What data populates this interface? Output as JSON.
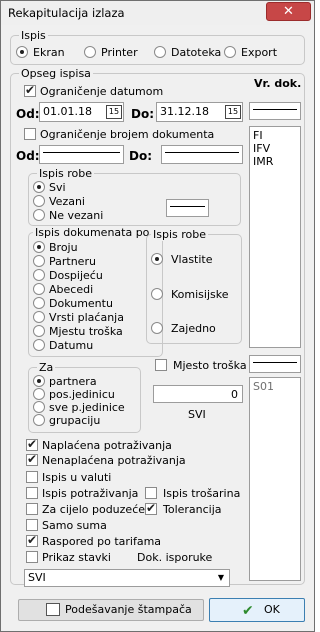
{
  "window": {
    "title": "Rekapitulacija izlaza",
    "close_glyph": "✕"
  },
  "ispis": {
    "title": "Ispis",
    "options": [
      "Ekran",
      "Printer",
      "Datoteka",
      "Export"
    ]
  },
  "opseg": {
    "title": "Opseg ispisa",
    "vr_dok_label": "Vr. dok.",
    "ogranicenje_datumom": "Ograničenje datumom",
    "od_label": "Od:",
    "od_value": "01.01.18",
    "do_label": "Do:",
    "do_value": "31.12.18",
    "cal_glyph": "15",
    "ogranicenje_brojem": "Ograničenje brojem dokumenta",
    "od2_label": "Od:",
    "do2_label": "Do:",
    "doc_types": [
      "FI",
      "IFV",
      "IMR"
    ]
  },
  "ispis_robe1": {
    "title": "Ispis robe",
    "options": [
      "Svi",
      "Vezani",
      "Ne vezani"
    ]
  },
  "ispis_dok": {
    "title": "Ispis dokumenata po",
    "options": [
      "Broju",
      "Partneru",
      "Dospijeću",
      "Abecedi",
      "Dokumentu",
      "Vrsti plaćanja",
      "Mjestu troška",
      "Datumu"
    ]
  },
  "ispis_robe2": {
    "title": "Ispis robe",
    "options": [
      "Vlastite",
      "Komisijske",
      "Zajedno"
    ]
  },
  "mjesto_troska": "Mjesto troška",
  "za": {
    "title": "Za",
    "options": [
      "partnera",
      "pos.jedinicu",
      "sve p.jedinice",
      "grupaciju"
    ]
  },
  "counter": {
    "value": "0",
    "label": "SVI"
  },
  "s_list": [
    "S01"
  ],
  "checks": {
    "naplacena": "Naplaćena potraživanja",
    "nenaplacena": "Nenaplaćena potraživanja",
    "u_valuti": "Ispis u valuti",
    "potrazivanja": "Ispis potraživanja",
    "trosarina": "Ispis trošarina",
    "cijelo_poduzece": "Za cijelo poduzeće",
    "tolerancija": "Tolerancija",
    "samo_suma": "Samo suma",
    "raspored": "Raspored po tarifama",
    "prikaz_stavki": "Prikaz stavki",
    "dok_isporuke": "Dok. isporuke"
  },
  "dropdown": {
    "value": "SVI",
    "arrow": "▼"
  },
  "buttons": {
    "podesavanje": "Podešavanje štampača",
    "ok": "OK",
    "ok_check": "✔"
  },
  "colors": {
    "ok_check": "#2e8b2e",
    "close_bg": "#c74747"
  }
}
